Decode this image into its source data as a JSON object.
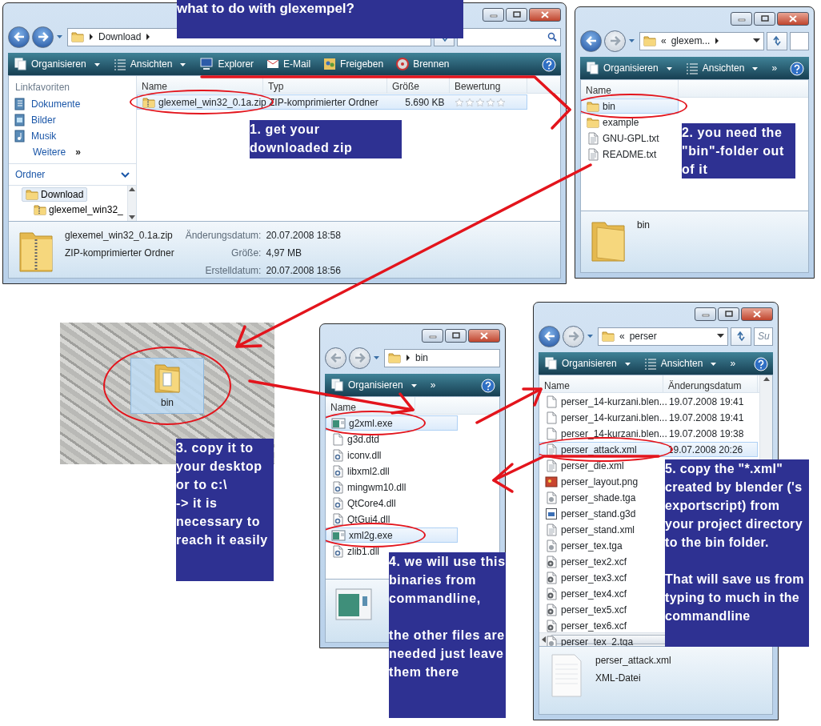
{
  "windows": [
    {
      "back_enabled": true,
      "forward_enabled": true,
      "crumb": "Download",
      "leading_arrow": true,
      "trailing_arrow": true,
      "dropdown": true,
      "search_box": true,
      "toolbar": [
        {
          "label": "Organisieren",
          "kind": "organize",
          "dropdown": true
        },
        {
          "label": "Ansichten",
          "kind": "views",
          "dropdown": true
        },
        {
          "label": "Explorer",
          "kind": "explorer",
          "dropdown": false
        },
        {
          "label": "E-Mail",
          "kind": "email",
          "dropdown": false
        },
        {
          "label": "Freigeben",
          "kind": "share",
          "dropdown": false
        },
        {
          "label": "Brennen",
          "kind": "burn",
          "dropdown": false
        }
      ],
      "nav_pane": {
        "heading": "Linkfavoriten",
        "links": [
          {
            "label": "Dokumente",
            "kind": "documents"
          },
          {
            "label": "Bilder",
            "kind": "pictures"
          },
          {
            "label": "Musik",
            "kind": "music"
          },
          {
            "label": "Weitere",
            "more": "»"
          }
        ],
        "folders_heading": "Ordner",
        "tree": [
          {
            "label": "Download",
            "kind": "folder",
            "selected": true,
            "children": [
              {
                "label": "glexemel_win32_",
                "kind": "zip",
                "selected": false
              }
            ]
          }
        ]
      },
      "columns": [
        "Name",
        "Typ",
        "Größe",
        "Bewertung"
      ],
      "files": [
        {
          "name": "glexemel_win32_0.1a.zip",
          "kind": "zip",
          "cells": [
            "ZIP-komprimierter Ordner",
            "5.690 KB"
          ],
          "stars": 0,
          "selected": true,
          "circled": true
        }
      ],
      "details": {
        "kind": "zip",
        "lines": [
          "glexemel_win32_0.1a.zip",
          "ZIP-komprimierter Ordner"
        ],
        "props": [
          {
            "label": "Änderungsdatum:",
            "value": "20.07.2008 18:58"
          },
          {
            "label": "Größe:",
            "value": "4,97 MB"
          },
          {
            "label": "Erstelldatum:",
            "value": "20.07.2008 18:56"
          }
        ]
      }
    },
    {
      "back_enabled": true,
      "forward_enabled": false,
      "overflow_mark": "«",
      "crumb": "glexem...",
      "leading_arrow": false,
      "trailing_arrow": true,
      "dropdown": true,
      "search_box": true,
      "toolbar": [
        {
          "label": "Organisieren",
          "kind": "organize",
          "dropdown": true
        },
        {
          "label": "Ansichten",
          "kind": "views",
          "dropdown": true
        }
      ],
      "more": "»",
      "columns": [
        "Name"
      ],
      "files": [
        {
          "name": "bin",
          "kind": "folder",
          "selected": true,
          "circled": true
        },
        {
          "name": "example",
          "kind": "folder",
          "selected": false,
          "circled": false
        },
        {
          "name": "GNU-GPL.txt",
          "kind": "text",
          "selected": false,
          "circled": false
        },
        {
          "name": "README.txt",
          "kind": "text",
          "selected": false,
          "circled": false
        }
      ],
      "details": {
        "kind": "folder",
        "lines": [
          "bin"
        ]
      }
    },
    {
      "back_enabled": false,
      "forward_enabled": false,
      "crumb": "bin",
      "leading_arrow": true,
      "trailing_arrow": false,
      "dropdown": false,
      "search_box": false,
      "toolbar": [
        {
          "label": "Organisieren",
          "kind": "organize",
          "dropdown": true
        }
      ],
      "more": "»",
      "columns": [
        "Name"
      ],
      "files": [
        {
          "name": "g2xml.exe",
          "kind": "exe",
          "selected": true,
          "circled": true
        },
        {
          "name": "g3d.dtd",
          "kind": "blank",
          "selected": false,
          "circled": false
        },
        {
          "name": "iconv.dll",
          "kind": "dll",
          "selected": false,
          "circled": false
        },
        {
          "name": "libxml2.dll",
          "kind": "dll",
          "selected": false,
          "circled": false
        },
        {
          "name": "mingwm10.dll",
          "kind": "dll",
          "selected": false,
          "circled": false
        },
        {
          "name": "QtCore4.dll",
          "kind": "dll",
          "selected": false,
          "circled": false
        },
        {
          "name": "QtGui4.dll",
          "kind": "dll",
          "selected": false,
          "circled": false
        },
        {
          "name": "xml2g.exe",
          "kind": "exe",
          "selected": true,
          "circled": true
        },
        {
          "name": "zlib1.dll",
          "kind": "dll",
          "selected": false,
          "circled": false
        }
      ],
      "details": {
        "kind": "app"
      }
    },
    {
      "back_enabled": true,
      "forward_enabled": false,
      "overflow_mark": "«",
      "crumb": "perser",
      "leading_arrow": false,
      "trailing_arrow": false,
      "dropdown": true,
      "search_box": true,
      "search_placeholder": "Su",
      "toolbar": [
        {
          "label": "Organisieren",
          "kind": "organize",
          "dropdown": true
        },
        {
          "label": "Ansichten",
          "kind": "views",
          "dropdown": true
        }
      ],
      "more": "»",
      "scrollbars": true,
      "columns": [
        "Name",
        "Änderungsdatum"
      ],
      "files": [
        {
          "name": "perser_14-kurzani.blen...",
          "kind": "blank",
          "cells": [
            "19.07.2008 19:41"
          ],
          "selected": false,
          "circled": false
        },
        {
          "name": "perser_14-kurzani.blen...",
          "kind": "blank",
          "cells": [
            "19.07.2008 19:41"
          ],
          "selected": false,
          "circled": false
        },
        {
          "name": "perser_14-kurzani.blen...",
          "kind": "blank",
          "cells": [
            "19.07.2008 19:38"
          ],
          "selected": false,
          "circled": false
        },
        {
          "name": "perser_attack.xml",
          "kind": "text",
          "cells": [
            "19.07.2008 20:26"
          ],
          "selected": true,
          "circled": true
        },
        {
          "name": "perser_die.xml",
          "kind": "text",
          "selected": false,
          "circled": false
        },
        {
          "name": "perser_layout.png",
          "kind": "image",
          "selected": false,
          "circled": false
        },
        {
          "name": "perser_shade.tga",
          "kind": "tga",
          "selected": false,
          "circled": false
        },
        {
          "name": "perser_stand.g3d",
          "kind": "g3d",
          "selected": false,
          "circled": false
        },
        {
          "name": "perser_stand.xml",
          "kind": "text",
          "selected": false,
          "circled": false
        },
        {
          "name": "perser_tex.tga",
          "kind": "tga",
          "selected": false,
          "circled": false
        },
        {
          "name": "perser_tex2.xcf",
          "kind": "xcf",
          "selected": false,
          "circled": false
        },
        {
          "name": "perser_tex3.xcf",
          "kind": "xcf",
          "selected": false,
          "circled": false
        },
        {
          "name": "perser_tex4.xcf",
          "kind": "xcf",
          "selected": false,
          "circled": false
        },
        {
          "name": "perser_tex5.xcf",
          "kind": "xcf",
          "selected": false,
          "circled": false
        },
        {
          "name": "perser_tex6.xcf",
          "kind": "xcf",
          "selected": false,
          "circled": false
        },
        {
          "name": "perser_tex_2.tga",
          "kind": "tga",
          "selected": false,
          "circled": false
        }
      ],
      "details": {
        "kind": "text",
        "lines": [
          "perser_attack.xml",
          "XML-Datei"
        ]
      }
    }
  ],
  "desktop": {
    "label": "bin",
    "selected": true,
    "circled": true
  },
  "notes": [
    "what to do with glexempel?",
    "1. get your downloaded zip",
    "2. you need the \"bin\"-folder out of it",
    "3. copy it to your desktop or to c:\\\n-> it is necessary to reach it easily",
    "4. we will use this binaries from commandline,\n\nthe other files are needed just leave them there",
    "5. copy the \"*.xml\" created by blender ('s exportscript) from your project directory to the bin folder.\n\nThat will save us from typing to much in the commandline"
  ]
}
